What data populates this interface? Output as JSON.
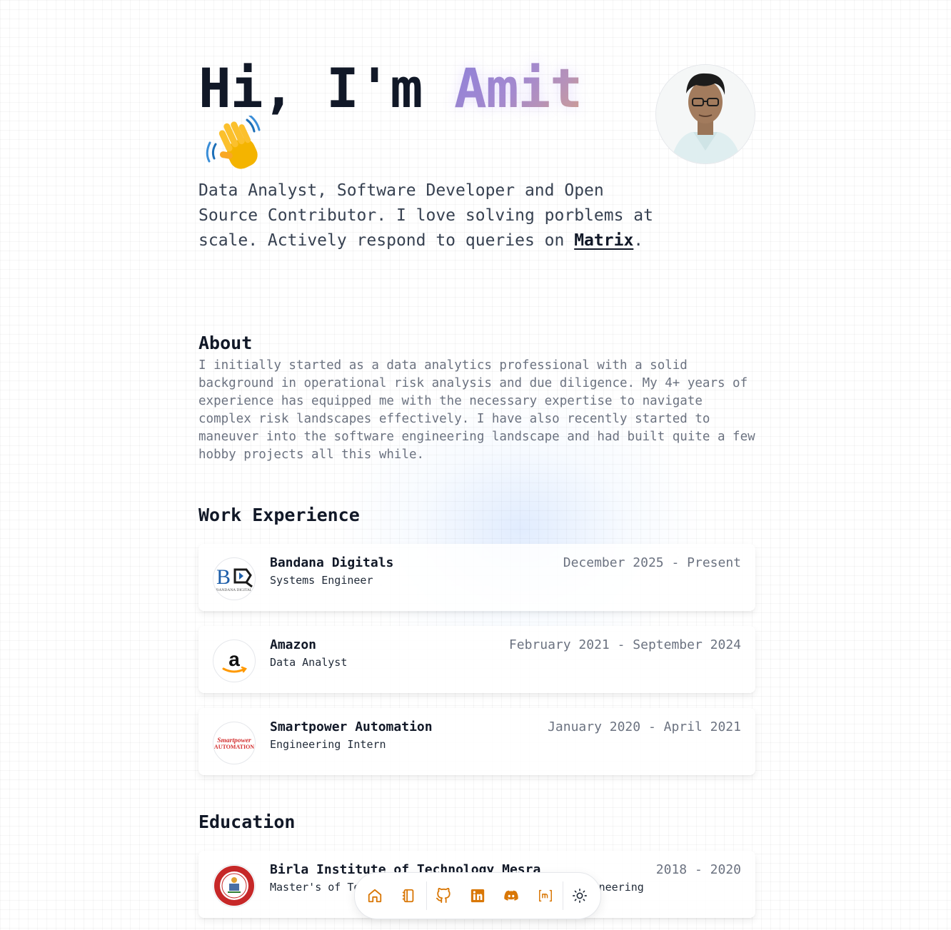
{
  "hero": {
    "greeting": "Hi, I'm ",
    "name": "Amit",
    "description": "Data Analyst, Software Developer and Open Source Contributor. I love solving porblems at scale. Actively respond to queries on ",
    "link_label": "Matrix",
    "description_end": "."
  },
  "about": {
    "title": "About",
    "text": "I initially started as a data analytics professional with a solid background in operational risk analysis and due diligence. My 4+ years of experience has equipped me with the necessary expertise to navigate complex risk landscapes effectively. I have also recently started to maneuver into the software engineering landscape and had built quite a few hobby projects all this while."
  },
  "work": {
    "title": "Work Experience",
    "items": [
      {
        "company": "Bandana Digitals",
        "role": "Systems Engineer",
        "date": "December 2025 - Present",
        "logo_text": "BANDANA DIGITAL"
      },
      {
        "company": "Amazon",
        "role": "Data Analyst",
        "date": "February 2021 - September 2024"
      },
      {
        "company": "Smartpower Automation",
        "role": "Engineering Intern",
        "date": "January 2020 - April 2021",
        "logo_line1": "Smartpower",
        "logo_line2": "AUTOMATION"
      }
    ]
  },
  "education": {
    "title": "Education",
    "items": [
      {
        "school": "Birla Institute of Technology Mesra",
        "degree": "Master's of Technology in Computer Science and Engineering",
        "date": "2018 - 2020"
      }
    ]
  },
  "dock": {
    "items": [
      "home-icon",
      "notebook-icon",
      "github-icon",
      "linkedin-icon",
      "discord-icon",
      "matrix-icon",
      "sun-icon"
    ],
    "accent": "#d97706"
  },
  "colors": {
    "accent": "#d97706",
    "name_gradient_start": "#8b7fd4",
    "name_gradient_end": "#d4a08a",
    "amazon_orange": "#ff9900",
    "smartpower_red": "#d32f2f",
    "bit_red": "#c62828"
  }
}
